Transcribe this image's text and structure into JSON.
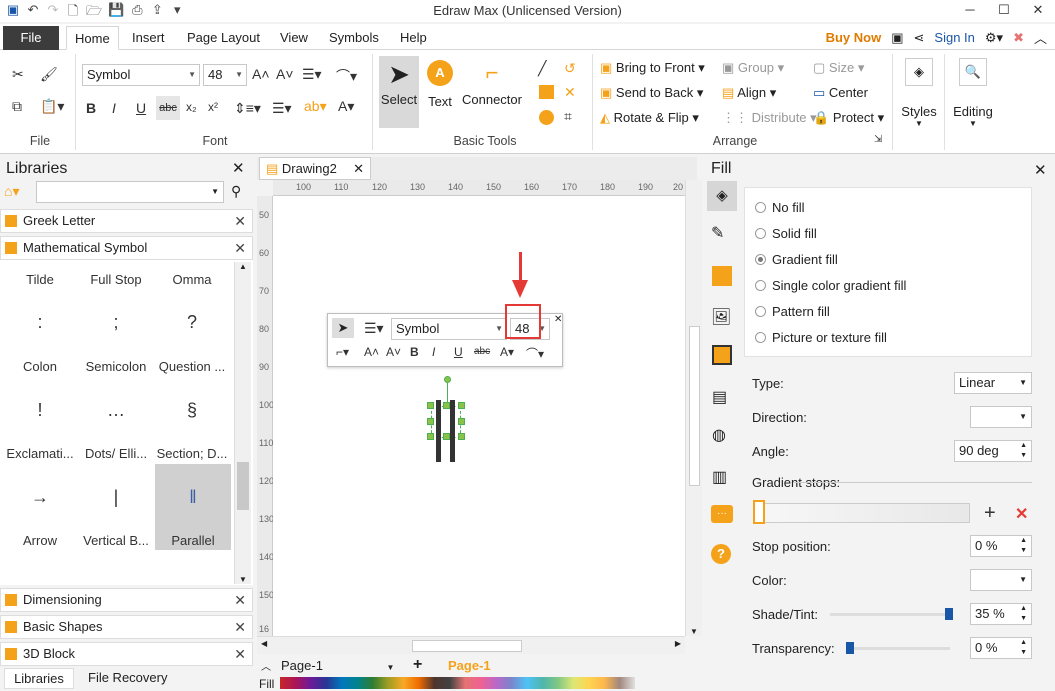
{
  "app_title": "Edraw Max (Unlicensed Version)",
  "menu": {
    "file": "File",
    "tabs": [
      "Home",
      "Insert",
      "Page Layout",
      "View",
      "Symbols",
      "Help"
    ],
    "buy_now": "Buy Now",
    "sign_in": "Sign In"
  },
  "ribbon": {
    "font_name": "Symbol",
    "font_size": "48",
    "group_file": "File",
    "group_font": "Font",
    "group_basic_tools": "Basic Tools",
    "group_arrange": "Arrange",
    "select": "Select",
    "text": "Text",
    "connector": "Connector",
    "bring_to_front": "Bring to Front",
    "send_to_back": "Send to Back",
    "rotate_flip": "Rotate & Flip",
    "group": "Group",
    "align": "Align",
    "distribute": "Distribute",
    "size": "Size",
    "center": "Center",
    "protect": "Protect",
    "styles": "Styles",
    "editing": "Editing"
  },
  "libraries": {
    "title": "Libraries",
    "categories_top": [
      "Greek Letter",
      "Mathematical Symbol"
    ],
    "symbols": [
      {
        "label": "Tilde",
        "glyph": ""
      },
      {
        "label": "Full Stop",
        "glyph": ""
      },
      {
        "label": "Omma",
        "glyph": ""
      },
      {
        "label": "Colon",
        "glyph": ":"
      },
      {
        "label": "Semicolon",
        "glyph": ";"
      },
      {
        "label": "Question ...",
        "glyph": "?"
      },
      {
        "label": "Exclamati...",
        "glyph": "!"
      },
      {
        "label": "Dots/ Elli...",
        "glyph": "…"
      },
      {
        "label": "Section; D...",
        "glyph": "§"
      },
      {
        "label": "Arrow",
        "glyph": "→"
      },
      {
        "label": "Vertical B...",
        "glyph": "|"
      },
      {
        "label": "Parallel",
        "glyph": "‖"
      }
    ],
    "categories_bottom": [
      "Dimensioning",
      "Basic Shapes",
      "3D Block"
    ],
    "bottom_tabs": [
      "Libraries",
      "File Recovery"
    ]
  },
  "document": {
    "tab": "Drawing2",
    "page_tab": "Page-1",
    "active_page": "Page-1",
    "fill_label": "Fill",
    "ruler_h": [
      "100",
      "110",
      "120",
      "130",
      "140",
      "150",
      "160",
      "170",
      "180",
      "190",
      "20"
    ],
    "ruler_v": [
      "50",
      "60",
      "70",
      "80",
      "90",
      "100",
      "110",
      "120",
      "130",
      "140",
      "150",
      "16"
    ]
  },
  "floating_toolbar": {
    "font": "Symbol",
    "size": "48"
  },
  "fill_panel": {
    "title": "Fill",
    "options": [
      "No fill",
      "Solid fill",
      "Gradient fill",
      "Single color gradient fill",
      "Pattern fill",
      "Picture or texture fill"
    ],
    "selected": "Gradient fill",
    "type_label": "Type:",
    "type_value": "Linear",
    "direction_label": "Direction:",
    "angle_label": "Angle:",
    "angle_value": "90 deg",
    "gradient_stops_label": "Gradient stops:",
    "stop_position_label": "Stop position:",
    "stop_position_value": "0 %",
    "color_label": "Color:",
    "shade_label": "Shade/Tint:",
    "shade_value": "35 %",
    "transparency_label": "Transparency:",
    "transparency_value": "0 %"
  },
  "colors": {
    "accent_orange": "#f5a21b",
    "highlight_red": "#e53935",
    "buy_now": "#e07b00",
    "file_tab": "#3c3c3c",
    "selection_green": "#4caf50"
  }
}
